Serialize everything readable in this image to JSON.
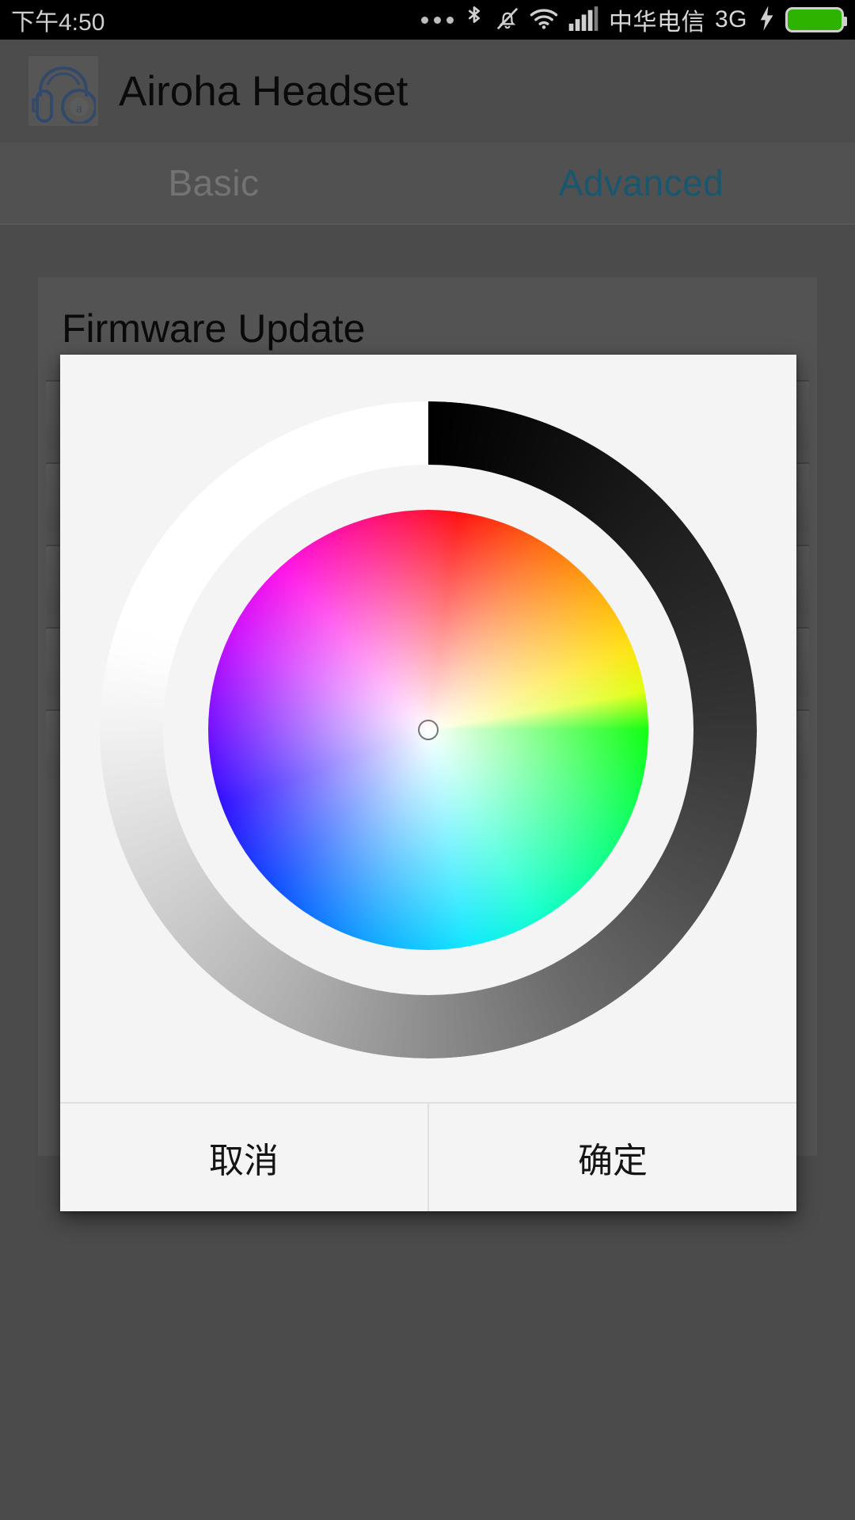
{
  "status_bar": {
    "time": "下午4:50",
    "carrier": "中华电信",
    "network": "3G",
    "icons": [
      "more-dots-icon",
      "bluetooth-icon",
      "mute-bell-icon",
      "wifi-icon",
      "signal-bars-icon",
      "charging-bolt-icon",
      "battery-icon"
    ],
    "battery_color": "#2db300"
  },
  "app_bar": {
    "title": "Airoha Headset",
    "logo_icon": "headset-icon",
    "logo_color": "#3d5a80"
  },
  "tabs": [
    {
      "label": "Basic",
      "active": false,
      "color": "#8d8d8d"
    },
    {
      "label": "Advanced",
      "active": true,
      "color": "#1e6b86"
    }
  ],
  "background": {
    "section_title": "Firmware Update",
    "row_count": 5
  },
  "dialog": {
    "type": "color-picker",
    "picker": {
      "wheel_marker_position": "center",
      "selected_color": "#ffffff",
      "brightness_handle_angle_deg": 180,
      "brightness_ring_start": "#000000",
      "brightness_ring_end": "#ffffff"
    },
    "buttons": [
      {
        "label": "取消",
        "role": "cancel"
      },
      {
        "label": "确定",
        "role": "confirm"
      }
    ]
  }
}
